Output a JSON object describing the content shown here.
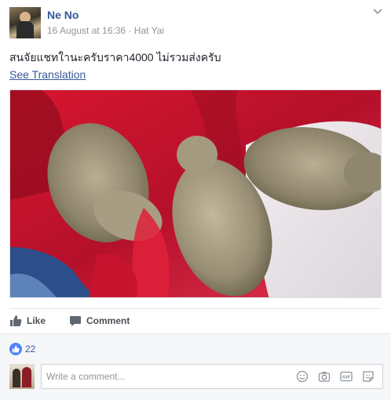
{
  "post": {
    "author": "Ne No",
    "timestamp": "16 August at 16:36",
    "separator": "·",
    "location": "Hat Yai",
    "text": "สนจัยแชทใานะครับราคา4000 ไม่รวมส่งครับ",
    "see_translation": "See Translation"
  },
  "actions": {
    "like_label": "Like",
    "comment_label": "Comment"
  },
  "reactions": {
    "like_count": "22"
  },
  "comment_composer": {
    "placeholder": "Write a comment..."
  },
  "icons": {
    "options": "chevron-down-icon",
    "like": "thumbs-up-icon",
    "comment": "speech-bubble-icon",
    "emoji": "smiley-icon",
    "camera": "camera-icon",
    "gif": "gif-icon",
    "sticker": "sticker-icon"
  },
  "colors": {
    "link": "#365899",
    "like_badge": "#4f81f7",
    "muted": "#90949c"
  }
}
